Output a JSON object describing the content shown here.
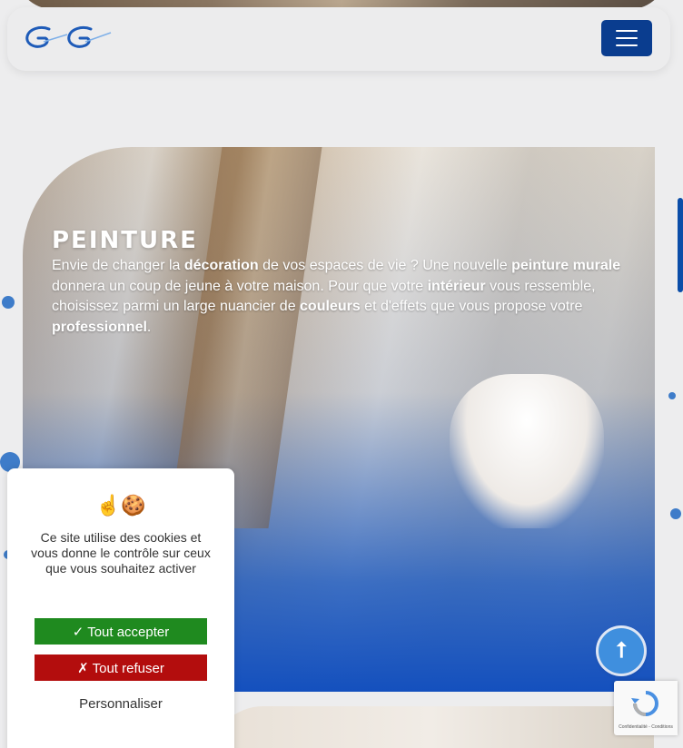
{
  "header": {
    "logo_alt": "logo",
    "menu_icon": "hamburger-icon",
    "brand_color": "#0a3d8f"
  },
  "hero": {
    "title": "PEINTURE",
    "text": [
      {
        "t": "Envie de changer la ",
        "b": false
      },
      {
        "t": "décoration",
        "b": true
      },
      {
        "t": " de vos espaces de vie ? Une nouvelle ",
        "b": false
      },
      {
        "t": "peinture murale",
        "b": true
      },
      {
        "t": " donnera un coup de jeune à votre maison. Pour que votre ",
        "b": false
      },
      {
        "t": "intérieur",
        "b": true
      },
      {
        "t": " vous ressemble, choisissez parmi un large nuancier de ",
        "b": false
      },
      {
        "t": "couleurs",
        "b": true
      },
      {
        "t": " et d'effets que vous propose votre ",
        "b": false
      },
      {
        "t": "professionnel",
        "b": true
      },
      {
        "t": ".",
        "b": false
      }
    ]
  },
  "cookie": {
    "emoji": "☝🍪",
    "message": "Ce site utilise des cookies et vous donne le contrôle sur ceux que vous souhaitez activer",
    "accept_label": "✓ Tout accepter",
    "refuse_label": "✗ Tout refuser",
    "customize_label": "Personnaliser",
    "accept_color": "#1f8a1f",
    "refuse_color": "#b30d0d"
  },
  "scroll_top": {
    "icon": "arrow-up-icon",
    "glyph": "⭡"
  },
  "recaptcha": {
    "label": "Confidentialité - Conditions",
    "icon": "recaptcha-icon"
  }
}
